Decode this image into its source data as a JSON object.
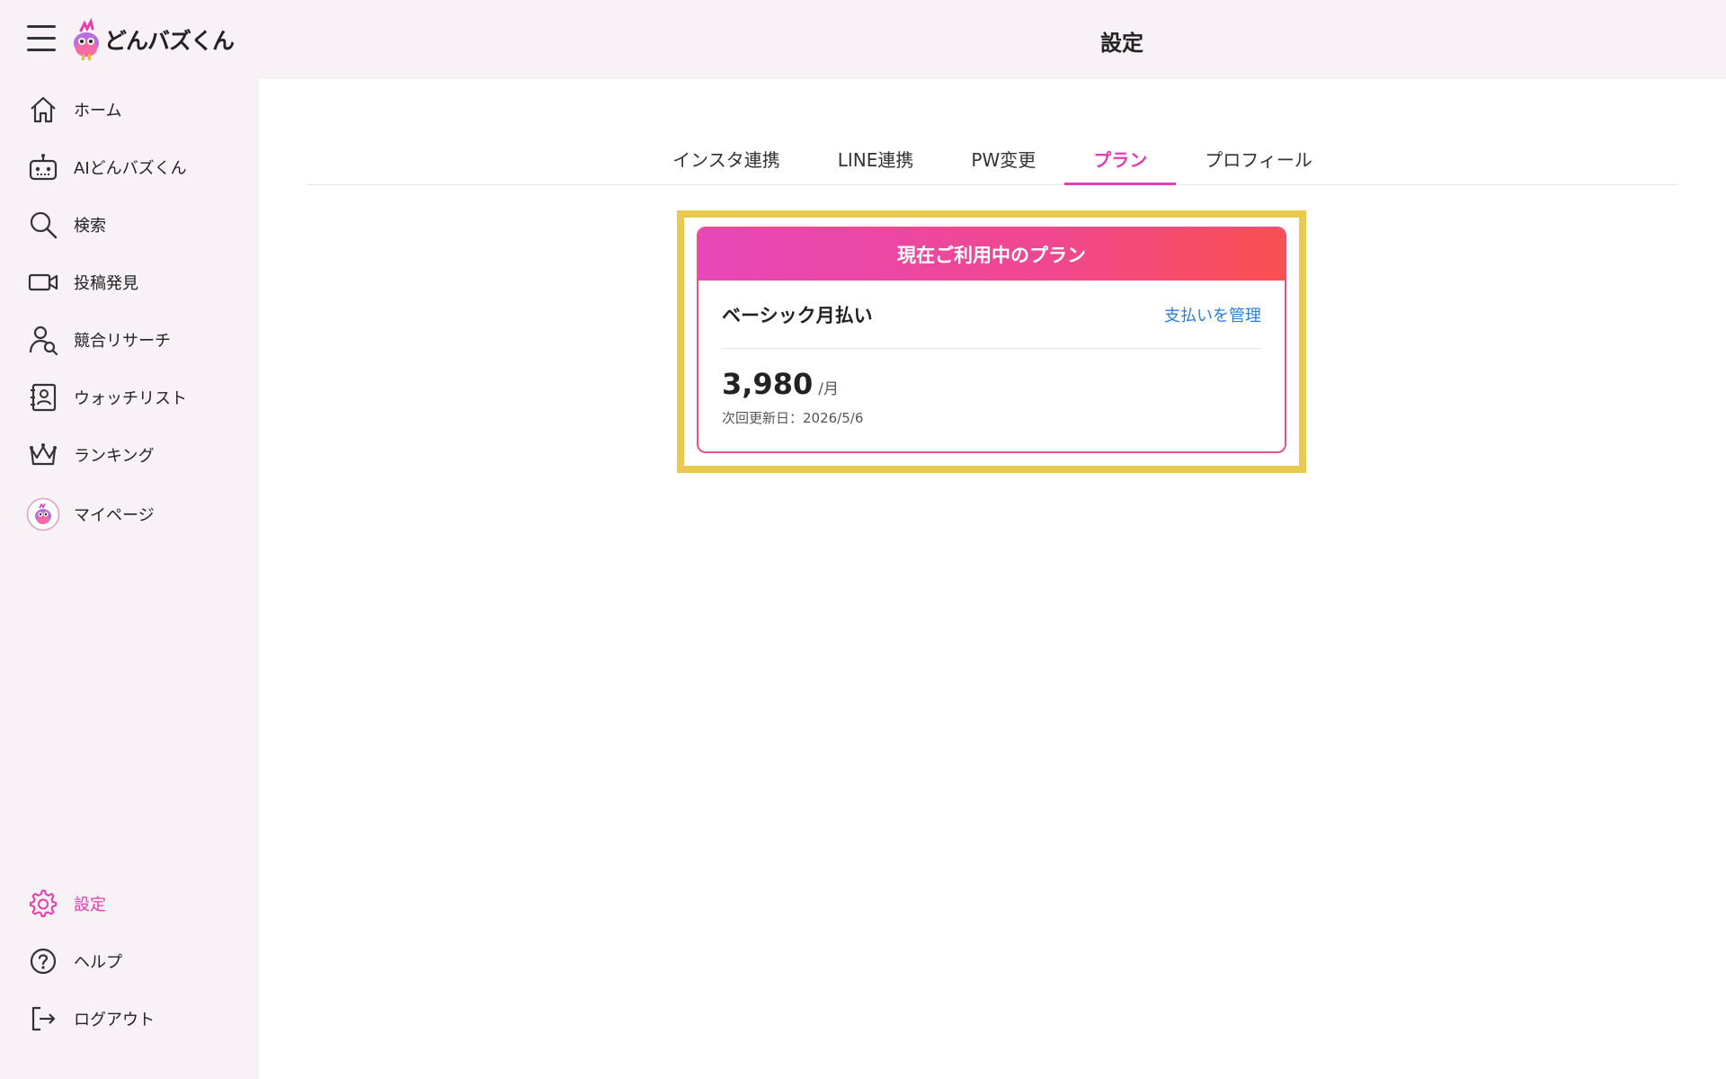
{
  "app": {
    "logo_text": "どんバズくん"
  },
  "header": {
    "title": "設定"
  },
  "sidebar": {
    "items": [
      {
        "label": "ホーム",
        "icon": "home-icon"
      },
      {
        "label": "AIどんバズくん",
        "icon": "robot-icon"
      },
      {
        "label": "検索",
        "icon": "search-icon"
      },
      {
        "label": "投稿発見",
        "icon": "video-camera-icon"
      },
      {
        "label": "競合リサーチ",
        "icon": "user-search-icon"
      },
      {
        "label": "ウォッチリスト",
        "icon": "contacts-book-icon"
      },
      {
        "label": "ランキング",
        "icon": "crown-icon"
      },
      {
        "label": "マイページ",
        "icon": "avatar-icon"
      }
    ],
    "bottom_items": [
      {
        "label": "設定",
        "icon": "gear-icon",
        "active": true
      },
      {
        "label": "ヘルプ",
        "icon": "help-circle-icon"
      },
      {
        "label": "ログアウト",
        "icon": "logout-icon"
      }
    ]
  },
  "tabs": [
    {
      "label": "インスタ連携"
    },
    {
      "label": "LINE連携"
    },
    {
      "label": "PW変更"
    },
    {
      "label": "プラン",
      "active": true
    },
    {
      "label": "プロフィール"
    }
  ],
  "plan": {
    "header": "現在ご利用中のプラン",
    "name": "ベーシック月払い",
    "manage_label": "支払いを管理",
    "price": "3,980",
    "unit": "/月",
    "renewal": "次回更新日：2026/5/6"
  },
  "colors": {
    "accent": "#e53cae",
    "link": "#2e7dd6",
    "highlight": "#eac94f",
    "gradient_start": "#e747b8",
    "gradient_end": "#fa4f4f"
  }
}
